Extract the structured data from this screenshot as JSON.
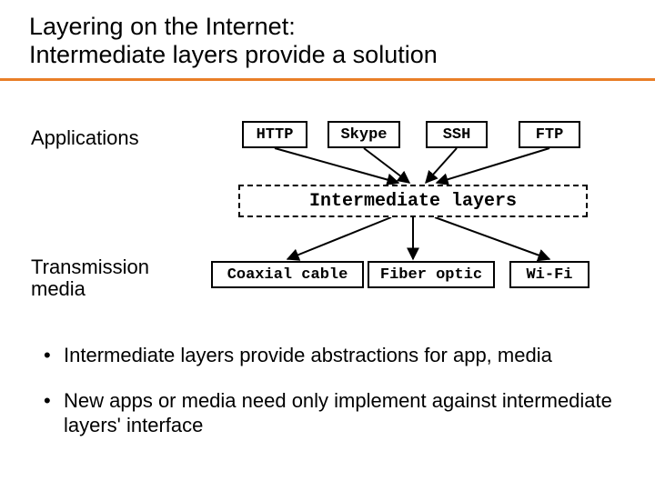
{
  "title_line1": "Layering on the Internet:",
  "title_line2": "Intermediate layers provide a solution",
  "labels": {
    "applications": "Applications",
    "transmission": "Transmission",
    "media": "media"
  },
  "apps": {
    "http": "HTTP",
    "skype": "Skype",
    "ssh": "SSH",
    "ftp": "FTP"
  },
  "intermediate": "Intermediate layers",
  "media": {
    "coax": "Coaxial cable",
    "fiber": "Fiber optic",
    "wifi": "Wi-Fi"
  },
  "bullet1": "Intermediate layers provide abstractions for app, media",
  "bullet2": "New apps or media need only implement against intermediate layers' interface"
}
